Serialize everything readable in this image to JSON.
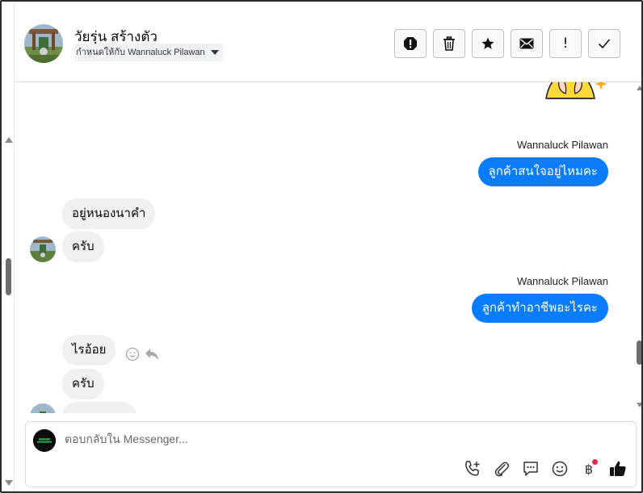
{
  "header": {
    "contact_name": "วัยรุ่น สร้างตัว",
    "assigned_to": "กำหนดให้กับ Wannaluck Pilawan",
    "toolbar_icons": [
      "spam-alert-icon",
      "trash-icon",
      "star-icon",
      "envelope-icon",
      "exclamation-icon",
      "checkmark-icon"
    ],
    "exclamation_glyph": "!"
  },
  "messages": [
    {
      "direction": "outgoing",
      "sender": "Wannaluck Pilawan",
      "text": "ลูกค้าสนใจอยู่ไหมคะ"
    },
    {
      "direction": "incoming",
      "text": "อยู่หนองนาคำ"
    },
    {
      "direction": "incoming",
      "text": "ครับ"
    },
    {
      "direction": "outgoing",
      "sender": "Wannaluck Pilawan",
      "text": "ลูกค้าทำอาชีพอะไรคะ"
    },
    {
      "direction": "incoming",
      "text": "ไรอ้อย"
    },
    {
      "direction": "incoming",
      "text": "ครับ"
    }
  ],
  "composer": {
    "placeholder": "ตอบกลับใน Messenger...",
    "baht_symbol": "฿",
    "icons": [
      "call-add-icon",
      "paperclip-icon",
      "saved-reply-icon",
      "emoji-icon",
      "baht-icon",
      "thumbs-up-icon"
    ]
  },
  "colors": {
    "accent": "#0a7cff",
    "incoming_bubble": "#f0f0f0",
    "notification_dot": "#f02849"
  }
}
